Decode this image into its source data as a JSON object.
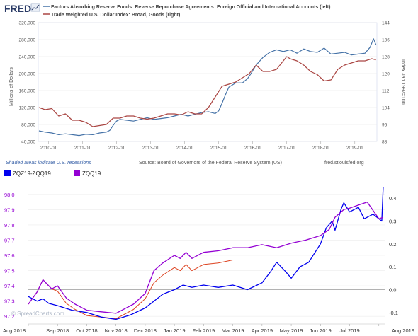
{
  "top_panel": {
    "logo_text": "FRED",
    "legend": [
      {
        "label": "Factors Absorbing Reserve Funds: Reverse Repurchase Agreements: Foreign Official and International Accounts (left)",
        "color": "#4572a7"
      },
      {
        "label": "Trade Weighted U.S. Dollar Index: Broad, Goods (right)",
        "color": "#aa4643"
      }
    ],
    "left_axis_label": "Millions of Dollars",
    "right_axis_label": "Index Jan 1997=100",
    "recession_note": "Shaded areas indicate U.S. recessions",
    "source_text": "Source: Board of Governors of the Federal Reserve System (US)",
    "site_text": "fred.stlouisfed.org"
  },
  "bottom_panel": {
    "legend": [
      {
        "label": "ZQZ19-ZQQ19",
        "color": "#0000ee"
      },
      {
        "label": "ZQQ19",
        "color": "#9400d3"
      }
    ],
    "watermark": "© SpreadCharts.com",
    "lower_line_color": "#dd4422"
  },
  "chart_data": [
    {
      "type": "line",
      "x_ticks": [
        "2010-01",
        "2011-01",
        "2012-01",
        "2013-01",
        "2014-01",
        "2015-01",
        "2016-01",
        "2017-01",
        "2018-01",
        "2019-01"
      ],
      "left_ticks": [
        "40,000",
        "80,000",
        "120,000",
        "160,000",
        "200,000",
        "240,000",
        "280,000",
        "320,000"
      ],
      "right_ticks": [
        "88",
        "96",
        "104",
        "112",
        "120",
        "128",
        "136",
        "144"
      ],
      "left_ylim": [
        40000,
        320000
      ],
      "right_ylim": [
        88,
        144
      ],
      "xlim": [
        2009.7,
        2019.65
      ],
      "series": [
        {
          "name": "Factors Absorbing Reserve Funds: Reverse Repurchase Agreements: Foreign Official and International Accounts (left)",
          "axis": "left",
          "color": "#4572a7",
          "points": [
            [
              2009.72,
              65000
            ],
            [
              2009.9,
              62000
            ],
            [
              2010.1,
              60000
            ],
            [
              2010.3,
              56000
            ],
            [
              2010.5,
              58000
            ],
            [
              2010.7,
              56000
            ],
            [
              2010.9,
              54000
            ],
            [
              2011.1,
              57000
            ],
            [
              2011.3,
              56000
            ],
            [
              2011.5,
              60000
            ],
            [
              2011.7,
              62000
            ],
            [
              2011.8,
              66000
            ],
            [
              2011.9,
              78000
            ],
            [
              2012.0,
              88000
            ],
            [
              2012.1,
              92000
            ],
            [
              2012.3,
              90000
            ],
            [
              2012.5,
              88000
            ],
            [
              2012.7,
              92000
            ],
            [
              2012.9,
              96000
            ],
            [
              2013.1,
              92000
            ],
            [
              2013.3,
              94000
            ],
            [
              2013.5,
              96000
            ],
            [
              2013.7,
              100000
            ],
            [
              2013.9,
              104000
            ],
            [
              2014.1,
              100000
            ],
            [
              2014.3,
              104000
            ],
            [
              2014.5,
              108000
            ],
            [
              2014.7,
              110000
            ],
            [
              2014.9,
              106000
            ],
            [
              2015.0,
              112000
            ],
            [
              2015.1,
              130000
            ],
            [
              2015.2,
              150000
            ],
            [
              2015.3,
              168000
            ],
            [
              2015.5,
              178000
            ],
            [
              2015.7,
              178000
            ],
            [
              2015.85,
              188000
            ],
            [
              2015.95,
              200000
            ],
            [
              2016.1,
              220000
            ],
            [
              2016.3,
              238000
            ],
            [
              2016.5,
              250000
            ],
            [
              2016.7,
              256000
            ],
            [
              2016.9,
              252000
            ],
            [
              2017.1,
              256000
            ],
            [
              2017.3,
              248000
            ],
            [
              2017.5,
              258000
            ],
            [
              2017.7,
              252000
            ],
            [
              2017.9,
              250000
            ],
            [
              2018.1,
              260000
            ],
            [
              2018.3,
              246000
            ],
            [
              2018.5,
              248000
            ],
            [
              2018.7,
              250000
            ],
            [
              2018.9,
              244000
            ],
            [
              2019.1,
              246000
            ],
            [
              2019.3,
              248000
            ],
            [
              2019.45,
              262000
            ],
            [
              2019.55,
              282000
            ],
            [
              2019.62,
              268000
            ]
          ]
        },
        {
          "name": "Trade Weighted U.S. Dollar Index: Broad, Goods (right)",
          "axis": "right",
          "color": "#aa4643",
          "points": [
            [
              2009.72,
              104
            ],
            [
              2009.9,
              103
            ],
            [
              2010.1,
              103.5
            ],
            [
              2010.3,
              100
            ],
            [
              2010.5,
              101
            ],
            [
              2010.7,
              98
            ],
            [
              2010.9,
              98
            ],
            [
              2011.1,
              97
            ],
            [
              2011.3,
              95
            ],
            [
              2011.5,
              95.5
            ],
            [
              2011.7,
              96
            ],
            [
              2011.9,
              99
            ],
            [
              2012.1,
              99
            ],
            [
              2012.3,
              100
            ],
            [
              2012.5,
              100
            ],
            [
              2012.7,
              99
            ],
            [
              2012.9,
              98.5
            ],
            [
              2013.1,
              99
            ],
            [
              2013.3,
              100
            ],
            [
              2013.5,
              101
            ],
            [
              2013.7,
              101
            ],
            [
              2013.9,
              100.5
            ],
            [
              2014.1,
              102
            ],
            [
              2014.3,
              101
            ],
            [
              2014.5,
              101
            ],
            [
              2014.7,
              104
            ],
            [
              2014.9,
              109
            ],
            [
              2015.1,
              114
            ],
            [
              2015.3,
              115
            ],
            [
              2015.5,
              116
            ],
            [
              2015.7,
              118
            ],
            [
              2015.9,
              120
            ],
            [
              2016.1,
              124
            ],
            [
              2016.3,
              121
            ],
            [
              2016.5,
              121
            ],
            [
              2016.7,
              122
            ],
            [
              2016.9,
              126
            ],
            [
              2017.0,
              128
            ],
            [
              2017.1,
              127
            ],
            [
              2017.3,
              126
            ],
            [
              2017.5,
              124
            ],
            [
              2017.7,
              121
            ],
            [
              2017.9,
              119.5
            ],
            [
              2018.1,
              116.5
            ],
            [
              2018.3,
              117
            ],
            [
              2018.5,
              122
            ],
            [
              2018.7,
              124
            ],
            [
              2018.9,
              125
            ],
            [
              2019.1,
              126
            ],
            [
              2019.3,
              126
            ],
            [
              2019.5,
              127
            ],
            [
              2019.62,
              126.5
            ]
          ]
        }
      ]
    },
    {
      "type": "line",
      "x_ticks": [
        "Aug 2018",
        "Sep 2018",
        "Oct 2018",
        "Nov 2018",
        "Dec 2018",
        "Jan 2019",
        "Feb 2019",
        "Mar 2019",
        "Apr 2019",
        "May 2019",
        "Jun 2019",
        "Jul 2019",
        "Aug 2019"
      ],
      "left_ticks": [
        "97.2",
        "97.3",
        "97.4",
        "97.5",
        "97.6",
        "97.7",
        "97.8",
        "97.9",
        "98.0"
      ],
      "right_ticks": [
        "-0.1",
        "0.0",
        "0.1",
        "0.2",
        "0.3",
        "0.4"
      ],
      "left_ylim": [
        97.15,
        98.05
      ],
      "right_ylim": [
        -0.15,
        0.45
      ],
      "xlim": [
        0,
        12.2
      ],
      "series": [
        {
          "name": "ZQZ19-ZQQ19",
          "axis": "right",
          "color": "#0000ee",
          "points": [
            [
              0.0,
              -0.03
            ],
            [
              0.3,
              -0.05
            ],
            [
              0.5,
              -0.04
            ],
            [
              0.7,
              -0.06
            ],
            [
              1.0,
              -0.07
            ],
            [
              1.5,
              -0.09
            ],
            [
              2.0,
              -0.1
            ],
            [
              2.5,
              -0.12
            ],
            [
              3.0,
              -0.13
            ],
            [
              3.5,
              -0.11
            ],
            [
              4.0,
              -0.08
            ],
            [
              4.3,
              -0.05
            ],
            [
              4.6,
              -0.02
            ],
            [
              5.0,
              0.0
            ],
            [
              5.3,
              0.02
            ],
            [
              5.6,
              0.01
            ],
            [
              6.0,
              0.02
            ],
            [
              6.5,
              0.01
            ],
            [
              7.0,
              0.02
            ],
            [
              7.5,
              0.0
            ],
            [
              8.0,
              0.03
            ],
            [
              8.3,
              0.08
            ],
            [
              8.5,
              0.12
            ],
            [
              8.8,
              0.08
            ],
            [
              9.0,
              0.05
            ],
            [
              9.3,
              0.1
            ],
            [
              9.6,
              0.12
            ],
            [
              10.0,
              0.2
            ],
            [
              10.2,
              0.27
            ],
            [
              10.4,
              0.3
            ],
            [
              10.5,
              0.26
            ],
            [
              10.7,
              0.35
            ],
            [
              10.8,
              0.38
            ],
            [
              11.0,
              0.34
            ],
            [
              11.3,
              0.36
            ],
            [
              11.5,
              0.31
            ],
            [
              11.8,
              0.33
            ],
            [
              12.0,
              0.31
            ],
            [
              12.1,
              0.3
            ],
            [
              12.15,
              0.45
            ]
          ]
        },
        {
          "name": "ZQQ19",
          "axis": "left",
          "color": "#9400d3",
          "points": [
            [
              0.0,
              97.28
            ],
            [
              0.3,
              97.36
            ],
            [
              0.5,
              97.44
            ],
            [
              0.8,
              97.38
            ],
            [
              1.0,
              97.4
            ],
            [
              1.3,
              97.32
            ],
            [
              1.6,
              97.28
            ],
            [
              2.0,
              97.24
            ],
            [
              2.5,
              97.23
            ],
            [
              3.0,
              97.22
            ],
            [
              3.3,
              97.25
            ],
            [
              3.6,
              97.28
            ],
            [
              4.0,
              97.35
            ],
            [
              4.3,
              97.5
            ],
            [
              4.6,
              97.55
            ],
            [
              5.0,
              97.6
            ],
            [
              5.2,
              97.58
            ],
            [
              5.4,
              97.62
            ],
            [
              5.6,
              97.58
            ],
            [
              6.0,
              97.62
            ],
            [
              6.5,
              97.63
            ],
            [
              7.0,
              97.65
            ],
            [
              7.5,
              97.65
            ],
            [
              8.0,
              97.67
            ],
            [
              8.5,
              97.65
            ],
            [
              9.0,
              97.68
            ],
            [
              9.5,
              97.7
            ],
            [
              10.0,
              97.73
            ],
            [
              10.3,
              97.77
            ],
            [
              10.5,
              97.85
            ],
            [
              10.8,
              97.9
            ],
            [
              11.0,
              97.91
            ],
            [
              11.3,
              97.93
            ],
            [
              11.6,
              97.95
            ],
            [
              12.0,
              97.84
            ],
            [
              12.15,
              97.85
            ]
          ]
        }
      ]
    }
  ]
}
